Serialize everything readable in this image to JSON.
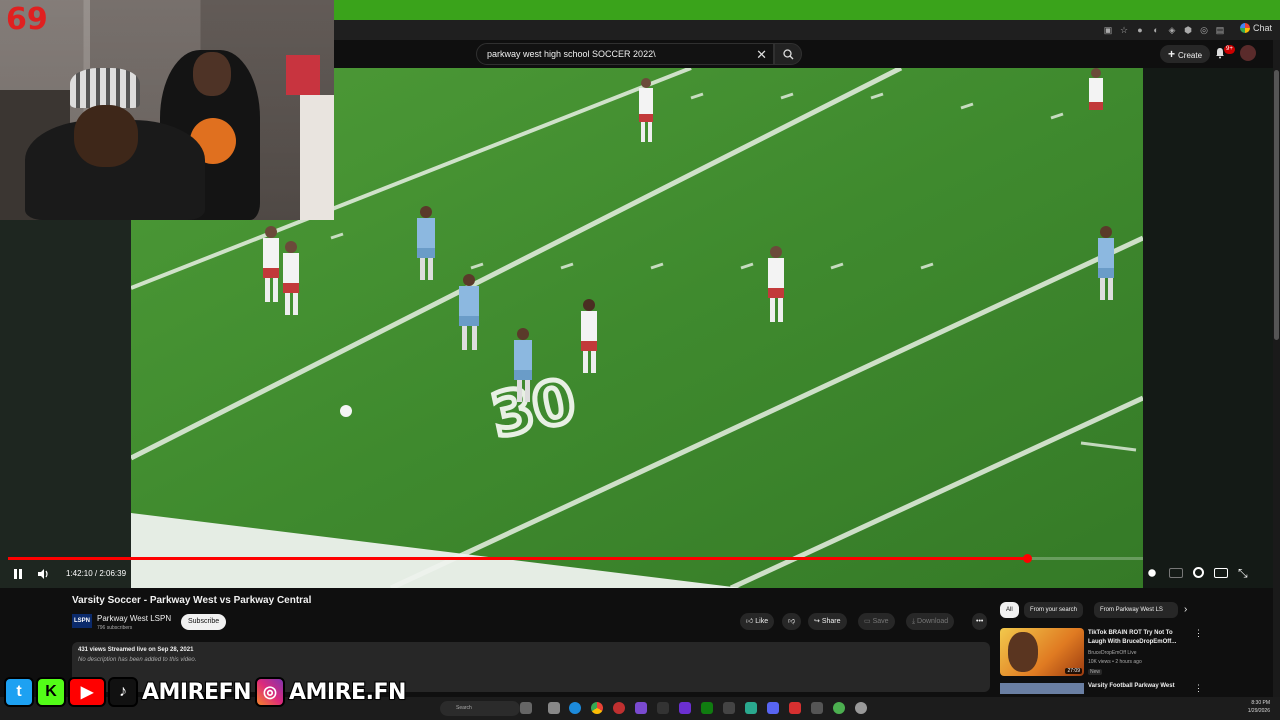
{
  "webcam": {
    "counter": "69"
  },
  "search": {
    "query": "parkway west high school SOCCER 2022\\"
  },
  "header": {
    "create_label": "Create",
    "notif_badge": "9+",
    "chat_label": "Chat"
  },
  "player": {
    "time": "1:42:10 / 2:06:39",
    "progress_fraction": 0.898,
    "field_number": "30"
  },
  "video": {
    "title": "Varsity Soccer - Parkway West vs Parkway Central",
    "channel": {
      "logo_text": "LSPN",
      "name": "Parkway West LSPN",
      "subs": "796 subscribers"
    },
    "subscribe_label": "Subscribe",
    "actions": {
      "like": "Like",
      "share": "Share",
      "save": "Save",
      "download": "Download"
    },
    "description": {
      "stats": "431 views  Streamed live on Sep 28, 2021",
      "text": "No description has been added to this video."
    }
  },
  "sidebar": {
    "chips": [
      "All",
      "From your search",
      "From Parkway West LS"
    ],
    "recs": [
      {
        "title": "TikTok BRAIN ROT Try Not To Laugh With BruceDropEmOff...",
        "channel": "BruceDropEmOff Live",
        "meta": "10K views • 2 hours ago",
        "badge": "New",
        "duration": "27:09"
      },
      {
        "title": "Varsity Football Parkway West"
      }
    ]
  },
  "taskbar": {
    "search_placeholder": "Search",
    "time": "8:30 PM",
    "date": "1/29/2026"
  },
  "overlay": {
    "handle1": "AMIREFN",
    "handle2": "AMIRE.FN"
  },
  "colors": {
    "accent_green": "#3aa31b",
    "yt_red": "#ff0000",
    "bg": "#0f0f0f"
  }
}
